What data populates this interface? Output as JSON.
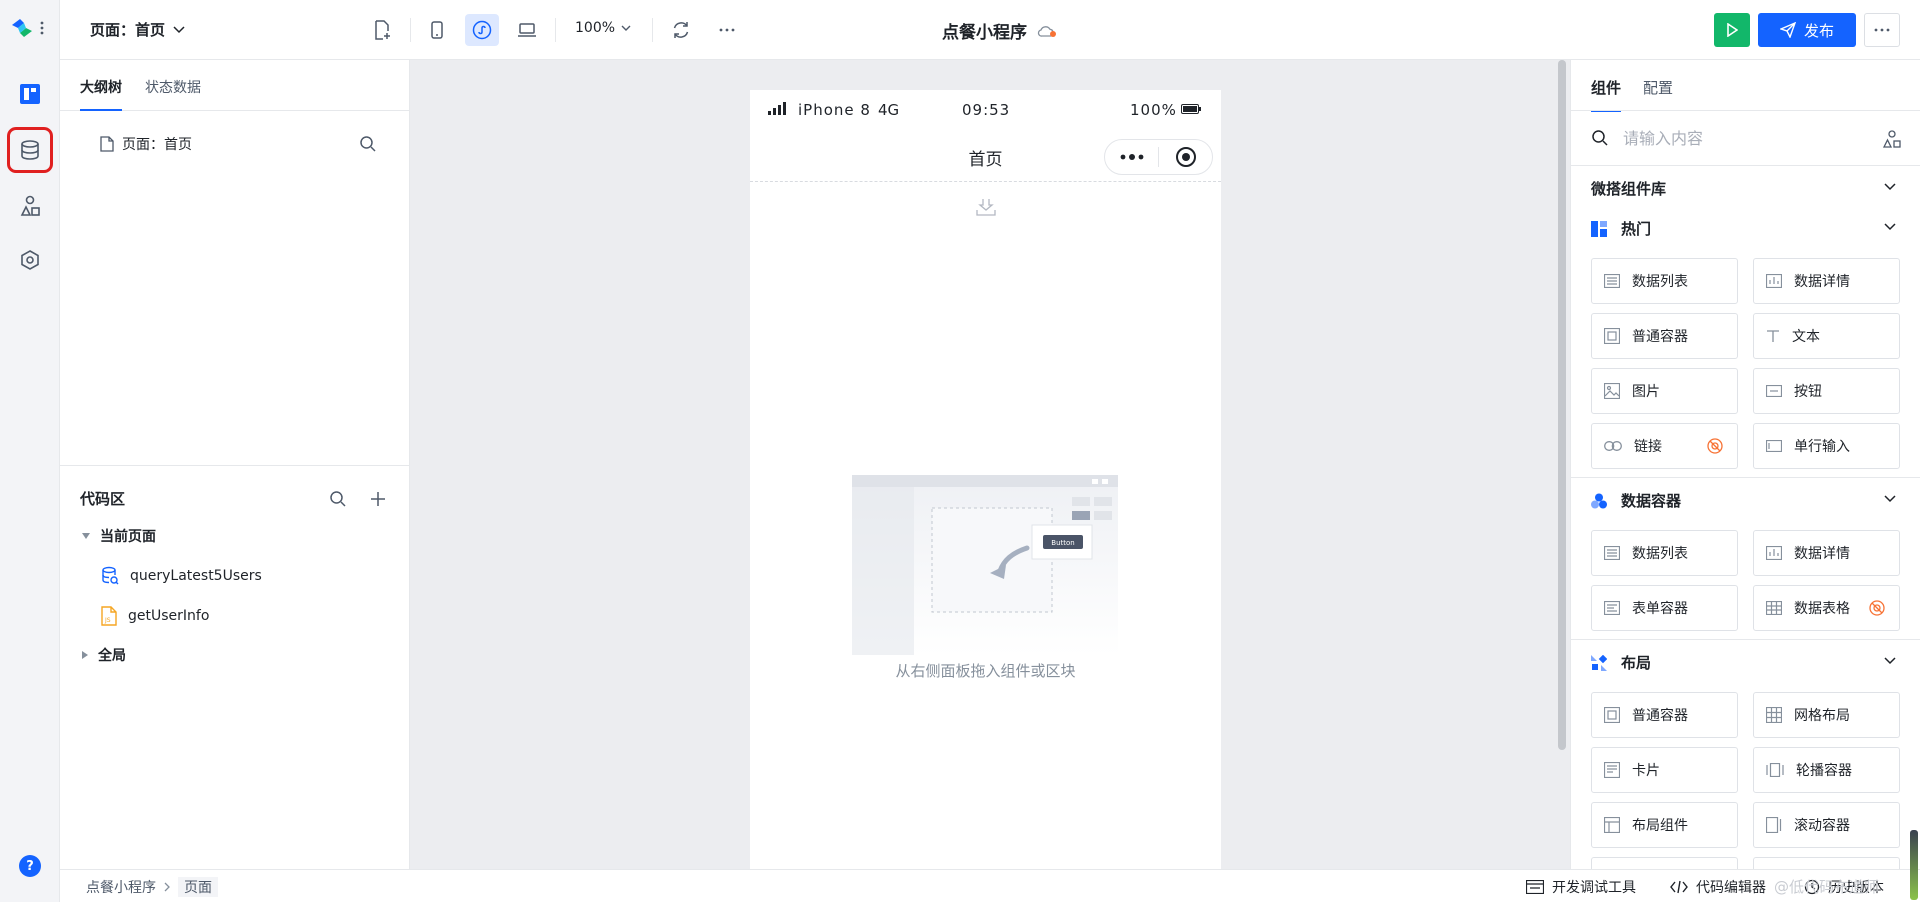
{
  "topbar": {
    "page_selector": "页面：首页",
    "zoom": "100%",
    "app_title": "点餐小程序",
    "publish_label": "发布"
  },
  "left_panel": {
    "tabs": [
      "大纲树",
      "状态数据"
    ],
    "tree_root": "页面：首页",
    "code_area": {
      "title": "代码区",
      "group_current": "当前页面",
      "items": [
        "queryLatest5Users",
        "getUserInfo"
      ],
      "group_global": "全局"
    }
  },
  "canvas": {
    "status_bar": {
      "carrier": "iPhone 8",
      "network": "4G",
      "time": "09:53",
      "battery": "100%"
    },
    "nav_title": "首页",
    "placeholder_button": "Button",
    "drop_hint": "从右侧面板拖入组件或区块"
  },
  "right_panel": {
    "tabs": [
      "组件",
      "配置"
    ],
    "search_placeholder": "请输入内容",
    "library_title": "微搭组件库",
    "sections": [
      {
        "title": "热门",
        "items": [
          "数据列表",
          "数据详情",
          "普通容器",
          "文本",
          "图片",
          "按钮",
          "链接",
          "单行输入"
        ]
      },
      {
        "title": "数据容器",
        "items": [
          "数据列表",
          "数据详情",
          "表单容器",
          "数据表格"
        ]
      },
      {
        "title": "布局",
        "items": [
          "普通容器",
          "网格布局",
          "卡片",
          "轮播容器",
          "布局组件",
          "滚动容器"
        ]
      }
    ]
  },
  "bottombar": {
    "breadcrumb": [
      "点餐小程序",
      "页面"
    ],
    "dev_tools": "开发调试工具",
    "code_editor": "代码编辑器",
    "history": "历史版本",
    "watermark": "@低代码布道师"
  },
  "colors": {
    "accent": "#1463ff",
    "run": "#12b76a",
    "highlight": "#e02020"
  }
}
